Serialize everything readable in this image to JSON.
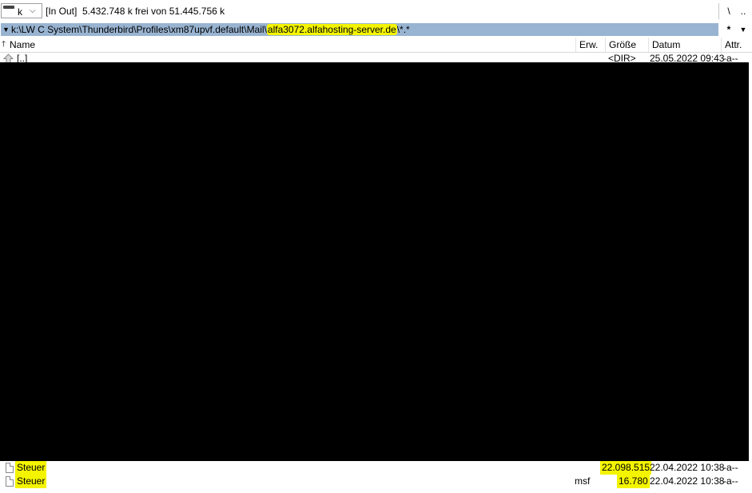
{
  "drive": {
    "letter": "k",
    "label": "[In Out]",
    "free_space": "5.432.748 k frei von 51.445.756 k",
    "root_button": "\\",
    "parent_button": ".."
  },
  "path": {
    "prefix": "k:\\LW C System\\Thunderbird\\Profiles\\xm87upvf.default\\Mail\\",
    "highlighted": "alfa3072.alfahosting-server.de",
    "suffix": "\\*.*",
    "filter_button": "*",
    "history_button": "▼",
    "dropdown": "▼"
  },
  "columns": {
    "sort_arrow": "🡑",
    "name": "Name",
    "ext": "Erw.",
    "size": "Größe",
    "date": "Datum",
    "attr": "Attr."
  },
  "rows": [
    {
      "name": "[..]",
      "ext": "",
      "size": "<DIR>",
      "date": "25.05.2022 09:43",
      "attr": "-a--"
    },
    {
      "name": "Steuer",
      "ext": "",
      "size": "22.098.515",
      "date": "22.04.2022 10:38",
      "attr": "-a--"
    },
    {
      "name": "Steuer",
      "ext": "msf",
      "size": "16.780",
      "date": "22.04.2022 10:38",
      "attr": "-a--"
    }
  ],
  "colors": {
    "highlight": "#f4f400",
    "path_background": "#99b4d1"
  }
}
